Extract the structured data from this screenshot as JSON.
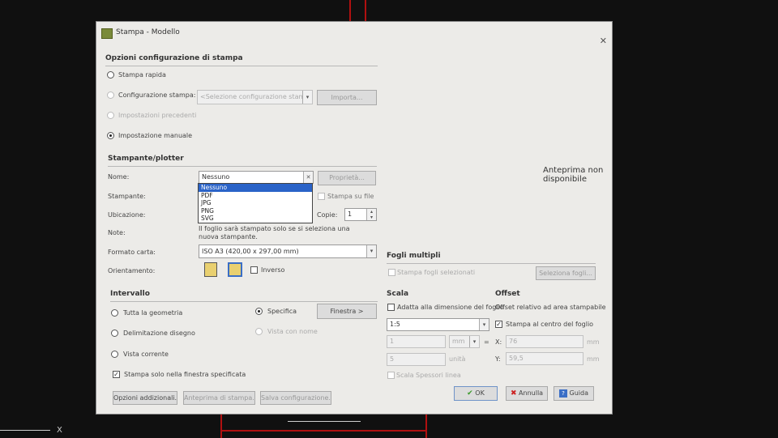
{
  "window": {
    "title": "Stampa - Modello",
    "close": "✕"
  },
  "setup": {
    "heading": "Opzioni configurazione di stampa",
    "quick": "Stampa rapida",
    "config_label": "Configurazione stampa:",
    "config_value": "<Selezione configurazione stampa>",
    "import_btn": "Importa...",
    "previous": "Impostazioni precedenti",
    "manual": "Impostazione manuale"
  },
  "printer": {
    "heading": "Stampante/plotter",
    "name_label": "Nome:",
    "name_value": "Nessuno",
    "properties_btn": "Proprietà...",
    "printer_label": "Stampante:",
    "location_label": "Ubicazione:",
    "note_label": "Note:",
    "note_text": "Il foglio sarà stampato solo se si seleziona una nuova stampante.",
    "print_to_file": "Stampa su file",
    "copies_label": "Copie:",
    "copies_value": "1",
    "options": [
      "Nessuno",
      "PDF",
      "JPG",
      "PNG",
      "SVG"
    ],
    "paper_label": "Formato carta:",
    "paper_value": "ISO A3 (420,00 x 297,00 mm)",
    "orientation_label": "Orientamento:",
    "inverse": "Inverso"
  },
  "preview": "Anteprima non disponibile",
  "multi": {
    "heading": "Fogli multipli",
    "print_selected": "Stampa fogli selezionati",
    "select_btn": "Seleziona fogli..."
  },
  "range": {
    "heading": "Intervallo",
    "all": "Tutta la geometria",
    "bounds": "Delimitazione disegno",
    "current": "Vista corrente",
    "specific": "Specifica",
    "window_btn": "Finestra >",
    "named": "Vista con nome",
    "only_window": "Stampa solo nella finestra specificata"
  },
  "scale": {
    "heading": "Scala",
    "fit": "Adatta alla dimensione del foglio",
    "ratio": "1:5",
    "val1": "1",
    "unit": "mm",
    "eq": "=",
    "val2": "5",
    "units_label": "unità",
    "lineweights": "Scala Spessori linea"
  },
  "offset": {
    "heading": "Offset",
    "relative": "Offset relativo ad area stampabile",
    "center": "Stampa al centro del foglio",
    "x_label": "X:",
    "x_value": "76",
    "y_label": "Y:",
    "y_value": "59,5",
    "unit": "mm"
  },
  "footer": {
    "more": "Opzioni addizionali...",
    "preview": "Anteprima di stampa...",
    "save": "Salva configurazione...",
    "ok": "OK",
    "cancel": "Annulla",
    "help": "Guida",
    "ok_mark": "✔",
    "cancel_mark": "✖",
    "help_mark": "?"
  },
  "background": {
    "axis_label": "X"
  }
}
